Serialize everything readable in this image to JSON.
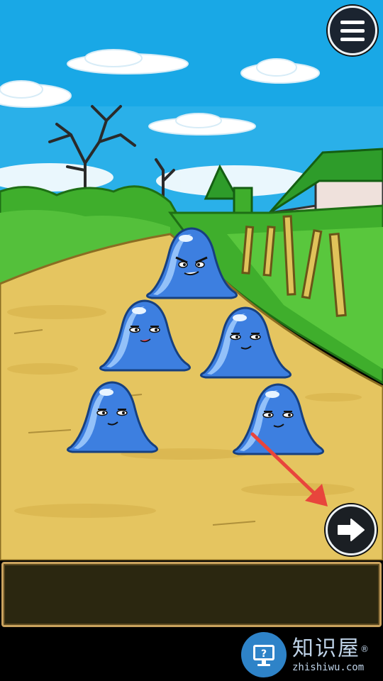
{
  "scene": {
    "name": "slime-field-scene",
    "colors": {
      "sky": "#19a8e6",
      "grass": "#3fae2c",
      "path": "#e5c560",
      "slime": "#3d7fe0",
      "hint_arrow": "#e8453c"
    }
  },
  "slimes": [
    {
      "expression": "angry"
    },
    {
      "expression": "smirk"
    },
    {
      "expression": "smirk"
    },
    {
      "expression": "smirk"
    },
    {
      "expression": "smirk"
    }
  ],
  "controls": {
    "menu_icon": "hamburger-menu-icon",
    "next_icon": "arrow-right-icon",
    "hint_icon": "red-arrow-pointer"
  },
  "dialog": {
    "text": ""
  },
  "watermark": {
    "title": "知识屋",
    "registered": "®",
    "url": "zhishiwu.com",
    "icon": "monitor-question-icon"
  }
}
